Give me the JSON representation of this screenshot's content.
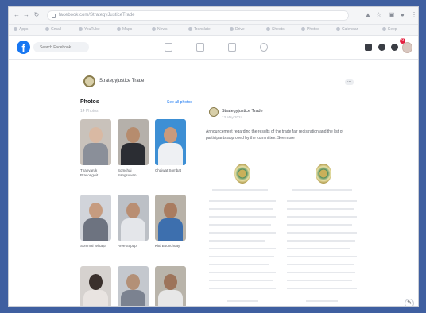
{
  "browser": {
    "url": "facebook.com/StrategyJusticeTrade",
    "bookmarks": [
      "Apps",
      "Gmail",
      "YouTube",
      "Maps",
      "News",
      "Translate",
      "Drive",
      "Sheets",
      "Photos",
      "Calendar",
      "Keep"
    ]
  },
  "facebook": {
    "search_placeholder": "Search Facebook",
    "notification_count": "9"
  },
  "page": {
    "name": "Strategyjustice Trade"
  },
  "photos_section": {
    "title": "Photos",
    "see_all": "See all photos",
    "count_text": "14 Photos",
    "people": [
      {
        "name": "Thanyaruk Prasongwit"
      },
      {
        "name": "Somchai Sangsuwan"
      },
      {
        "name": "Chaiwat Sombat"
      },
      {
        "name": "Sommai Wittaya"
      },
      {
        "name": "Aree Supap"
      },
      {
        "name": "Kitti Boonchuay"
      },
      {
        "name": ""
      },
      {
        "name": ""
      },
      {
        "name": ""
      }
    ]
  },
  "post": {
    "author": "Strategyjustice Trade",
    "date": "13 May 2024",
    "text": "Announcement regarding the results of the trade fair registration and the list of participants approved by the committee. See more"
  },
  "colors": {
    "accent": "#1877f2",
    "background": "#3f5fa0"
  }
}
